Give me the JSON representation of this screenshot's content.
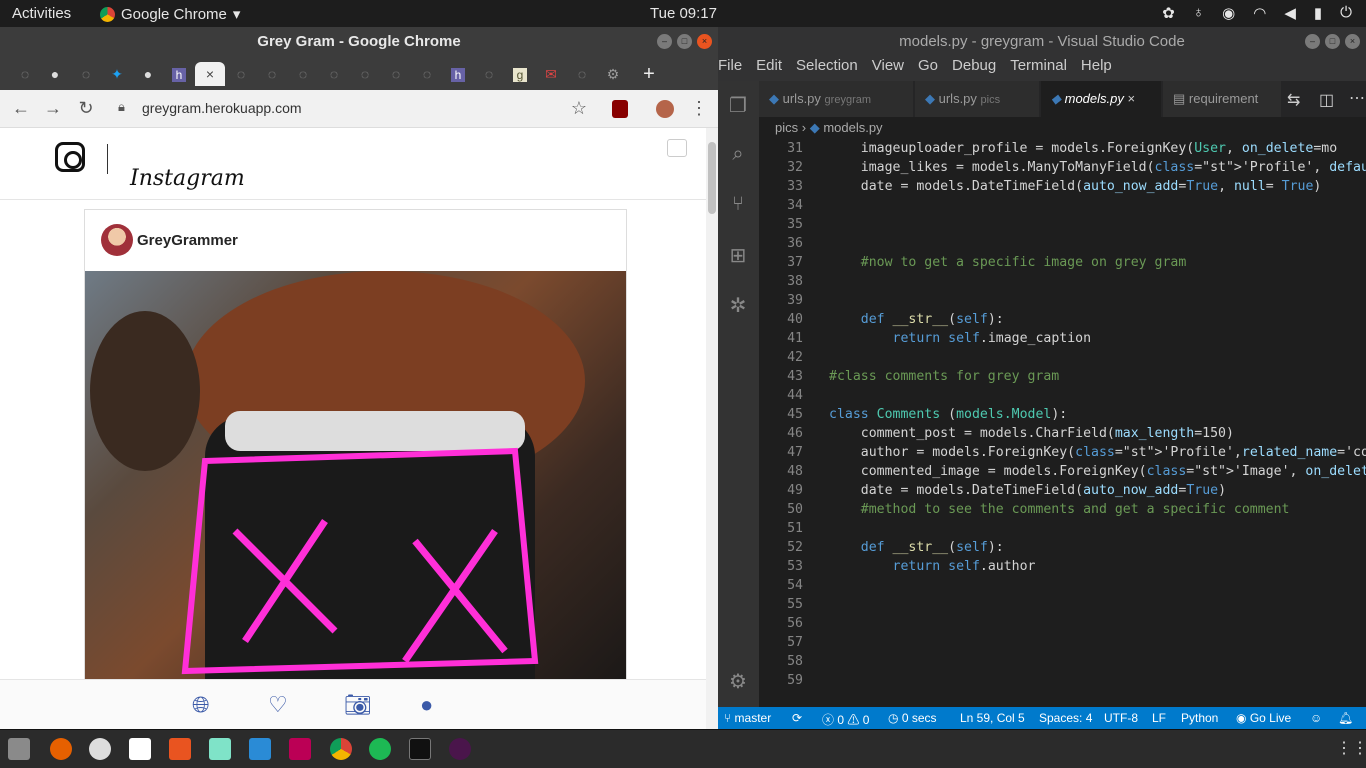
{
  "topbar": {
    "activities": "Activities",
    "app": "Google Chrome",
    "clock": "Tue 09:17"
  },
  "chrome": {
    "title": "Grey Gram - Google Chrome",
    "url": "greygram.herokuapp.com",
    "new_tab": "+"
  },
  "instagram": {
    "wordmark": "Instagram",
    "username": "GreyGrammer"
  },
  "vscode": {
    "title": "models.py - greygram - Visual Studio Code",
    "menu": [
      "File",
      "Edit",
      "Selection",
      "View",
      "Go",
      "Debug",
      "Terminal",
      "Help"
    ],
    "tabs": [
      {
        "name": "urls.py",
        "folder": "greygram"
      },
      {
        "name": "urls.py",
        "folder": "pics"
      },
      {
        "name": "models.py",
        "folder": ""
      },
      {
        "name": "requirement",
        "folder": ""
      }
    ],
    "breadcrumb": {
      "folder": "pics",
      "file": "models.py"
    },
    "status": {
      "branch": "master",
      "errors": "0",
      "warnings": "0",
      "time": "0 secs",
      "position": "Ln 59, Col 5",
      "spaces": "Spaces: 4",
      "encoding": "UTF-8",
      "eol": "LF",
      "language": "Python",
      "golive": "Go Live"
    }
  },
  "code": [
    {
      "n": "31",
      "t": "    imageuploader_profile = models.ForeignKey(User, on_delete=mo"
    },
    {
      "n": "32",
      "t": "    image_likes = models.ManyToManyField('Profile', default=Fals"
    },
    {
      "n": "33",
      "t": "    date = models.DateTimeField(auto_now_add=True, null= True)"
    },
    {
      "n": "34",
      "t": ""
    },
    {
      "n": "35",
      "t": ""
    },
    {
      "n": "36",
      "t": ""
    },
    {
      "n": "37",
      "t": "    #now to get a specific image on grey gram"
    },
    {
      "n": "38",
      "t": ""
    },
    {
      "n": "39",
      "t": ""
    },
    {
      "n": "40",
      "t": "    def __str__(self):"
    },
    {
      "n": "41",
      "t": "        return self.image_caption"
    },
    {
      "n": "42",
      "t": ""
    },
    {
      "n": "43",
      "t": "#class comments for grey gram"
    },
    {
      "n": "44",
      "t": ""
    },
    {
      "n": "45",
      "t": "class Comments (models.Model):"
    },
    {
      "n": "46",
      "t": "    comment_post = models.CharField(max_length=150)"
    },
    {
      "n": "47",
      "t": "    author = models.ForeignKey('Profile',related_name='commenter"
    },
    {
      "n": "48",
      "t": "    commented_image = models.ForeignKey('Image', on_delete=model"
    },
    {
      "n": "49",
      "t": "    date = models.DateTimeField(auto_now_add=True)"
    },
    {
      "n": "50",
      "t": "    #method to see the comments and get a specific comment"
    },
    {
      "n": "51",
      "t": ""
    },
    {
      "n": "52",
      "t": "    def __str__(self):"
    },
    {
      "n": "53",
      "t": "        return self.author"
    },
    {
      "n": "54",
      "t": ""
    },
    {
      "n": "55",
      "t": ""
    },
    {
      "n": "56",
      "t": ""
    },
    {
      "n": "57",
      "t": ""
    },
    {
      "n": "58",
      "t": ""
    },
    {
      "n": "59",
      "t": ""
    }
  ]
}
